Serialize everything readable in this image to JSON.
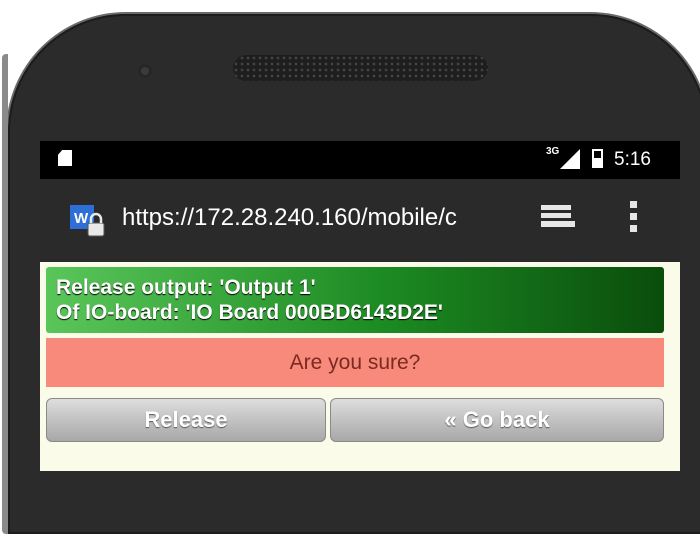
{
  "status_bar": {
    "signal_label": "3G",
    "time": "5:16"
  },
  "browser": {
    "url": "https://172.28.240.160/mobile/c"
  },
  "dialog": {
    "line1": "Release output: 'Output 1'",
    "line2": "Of IO-board: 'IO Board 000BD6143D2E'",
    "confirm_text": "Are you sure?",
    "release_label": "Release",
    "back_label": "« Go back"
  },
  "colors": {
    "info_green_start": "#5ac65a",
    "info_green_end": "#0a4d0c",
    "confirm_bg": "#f88a7b",
    "content_bg": "#fbfbea"
  }
}
